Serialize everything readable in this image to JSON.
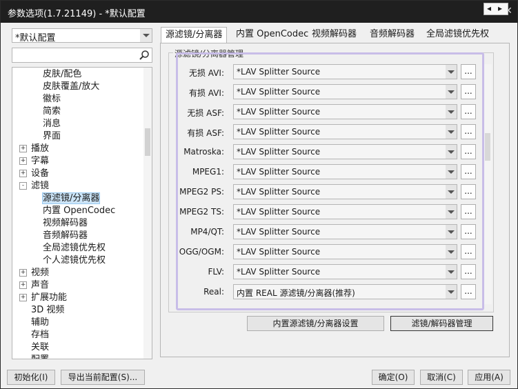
{
  "window": {
    "title": "参数选项(1.7.21149) - *默认配置",
    "pin_glyph": "⚑",
    "close_glyph": "✕"
  },
  "profile": {
    "value": "*默认配置"
  },
  "tree": {
    "items": [
      {
        "label": "皮肤/配色",
        "level": 2
      },
      {
        "label": "皮肤覆盖/放大",
        "level": 2
      },
      {
        "label": "徽标",
        "level": 2
      },
      {
        "label": "简索",
        "level": 2
      },
      {
        "label": "消息",
        "level": 2
      },
      {
        "label": "界面",
        "level": 2
      },
      {
        "label": "播放",
        "level": 1,
        "expander": "+"
      },
      {
        "label": "字幕",
        "level": 1,
        "expander": "+"
      },
      {
        "label": "设备",
        "level": 1,
        "expander": "+"
      },
      {
        "label": "滤镜",
        "level": 1,
        "expander": "-"
      },
      {
        "label": "源滤镜/分离器",
        "level": 2,
        "selected": true
      },
      {
        "label": "内置 OpenCodec",
        "level": 2
      },
      {
        "label": "视频解码器",
        "level": 2
      },
      {
        "label": "音频解码器",
        "level": 2
      },
      {
        "label": "全局滤镜优先权",
        "level": 2
      },
      {
        "label": "个人滤镜优先权",
        "level": 2
      },
      {
        "label": "视频",
        "level": 1,
        "expander": "+"
      },
      {
        "label": "声音",
        "level": 1,
        "expander": "+"
      },
      {
        "label": "扩展功能",
        "level": 1,
        "expander": "+"
      },
      {
        "label": "3D 视频",
        "level": 1
      },
      {
        "label": "辅助",
        "level": 1
      },
      {
        "label": "存档",
        "level": 1
      },
      {
        "label": "关联",
        "level": 1
      },
      {
        "label": "配置",
        "level": 1
      }
    ]
  },
  "tabs": [
    {
      "label": "源滤镜/分离器",
      "active": true
    },
    {
      "label": "内置 OpenCodec"
    },
    {
      "label": "视频解码器"
    },
    {
      "label": "音频解码器"
    },
    {
      "label": "全局滤镜优先权"
    }
  ],
  "tab_arrows": {
    "left": "◂",
    "right": "▸"
  },
  "group": {
    "title": "源滤镜/分离器管理"
  },
  "rows": [
    {
      "label": "无损 AVI:",
      "value": "*LAV Splitter Source"
    },
    {
      "label": "有损 AVI:",
      "value": "*LAV Splitter Source"
    },
    {
      "label": "无损 ASF:",
      "value": "*LAV Splitter Source"
    },
    {
      "label": "有损 ASF:",
      "value": "*LAV Splitter Source"
    },
    {
      "label": "Matroska:",
      "value": "*LAV Splitter Source"
    },
    {
      "label": "MPEG1:",
      "value": "*LAV Splitter Source"
    },
    {
      "label": "MPEG2 PS:",
      "value": "*LAV Splitter Source"
    },
    {
      "label": "MPEG2 TS:",
      "value": "*LAV Splitter Source"
    },
    {
      "label": "MP4/QT:",
      "value": "*LAV Splitter Source"
    },
    {
      "label": "OGG/OGM:",
      "value": "*LAV Splitter Source"
    },
    {
      "label": "FLV:",
      "value": "*LAV Splitter Source"
    },
    {
      "label": "Real:",
      "value": "内置 REAL 源滤镜/分离器(推荐)"
    }
  ],
  "dots_label": "...",
  "panel_buttons": {
    "builtin_settings": "内置源滤镜/分离器设置",
    "manage": "滤镜/解码器管理"
  },
  "footer": {
    "init": "初始化(I)",
    "export": "导出当前配置(S)...",
    "ok": "确定(O)",
    "cancel": "取消(C)",
    "apply": "应用(A)"
  },
  "colors": {
    "titlebar": "#1f1f1f",
    "highlight": "#c8bde8",
    "selection": "#cce4f7"
  }
}
